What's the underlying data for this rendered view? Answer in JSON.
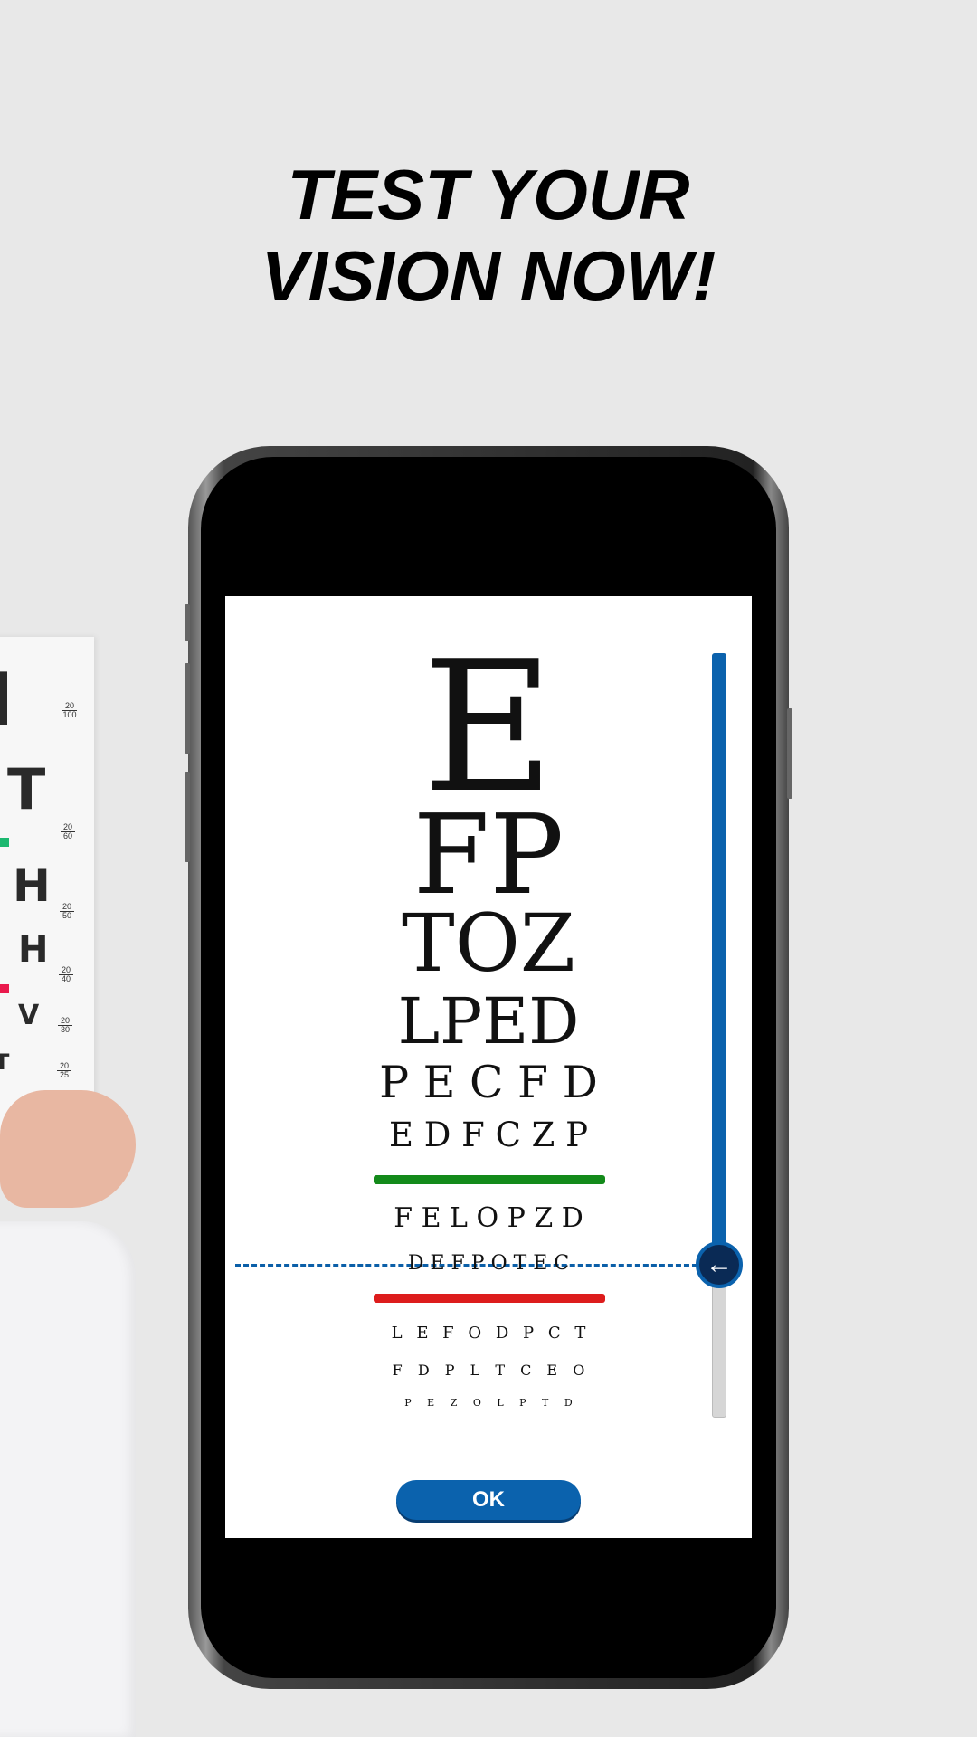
{
  "headline": {
    "line1": "TEST YOUR",
    "line2": "VISION NOW!"
  },
  "background_chart": {
    "letters": [
      "T",
      "H",
      "H",
      "V",
      "T"
    ],
    "acuity": [
      [
        "20",
        "100"
      ],
      [
        "20",
        "60"
      ],
      [
        "20",
        "50"
      ],
      [
        "20",
        "40"
      ],
      [
        "20",
        "30"
      ],
      [
        "20",
        "25"
      ]
    ]
  },
  "eye_chart": {
    "rows": [
      "E",
      "FP",
      "TOZ",
      "LPED",
      "P E C F D",
      "E D F C Z P",
      "F E L O P Z D",
      "D E F P O T E C",
      "L E F O D P C T",
      "F D P L T C E O",
      "P E Z O L P T D"
    ],
    "pass_line_color": "#138a1a",
    "fail_line_color": "#dd1c1c"
  },
  "slider": {
    "level_from_bottom": 0.2,
    "fill_color": "#0b62ad",
    "thumb_icon": "arrow-left-icon",
    "thumb_glyph": "←"
  },
  "ok_button": {
    "label": "OK"
  }
}
